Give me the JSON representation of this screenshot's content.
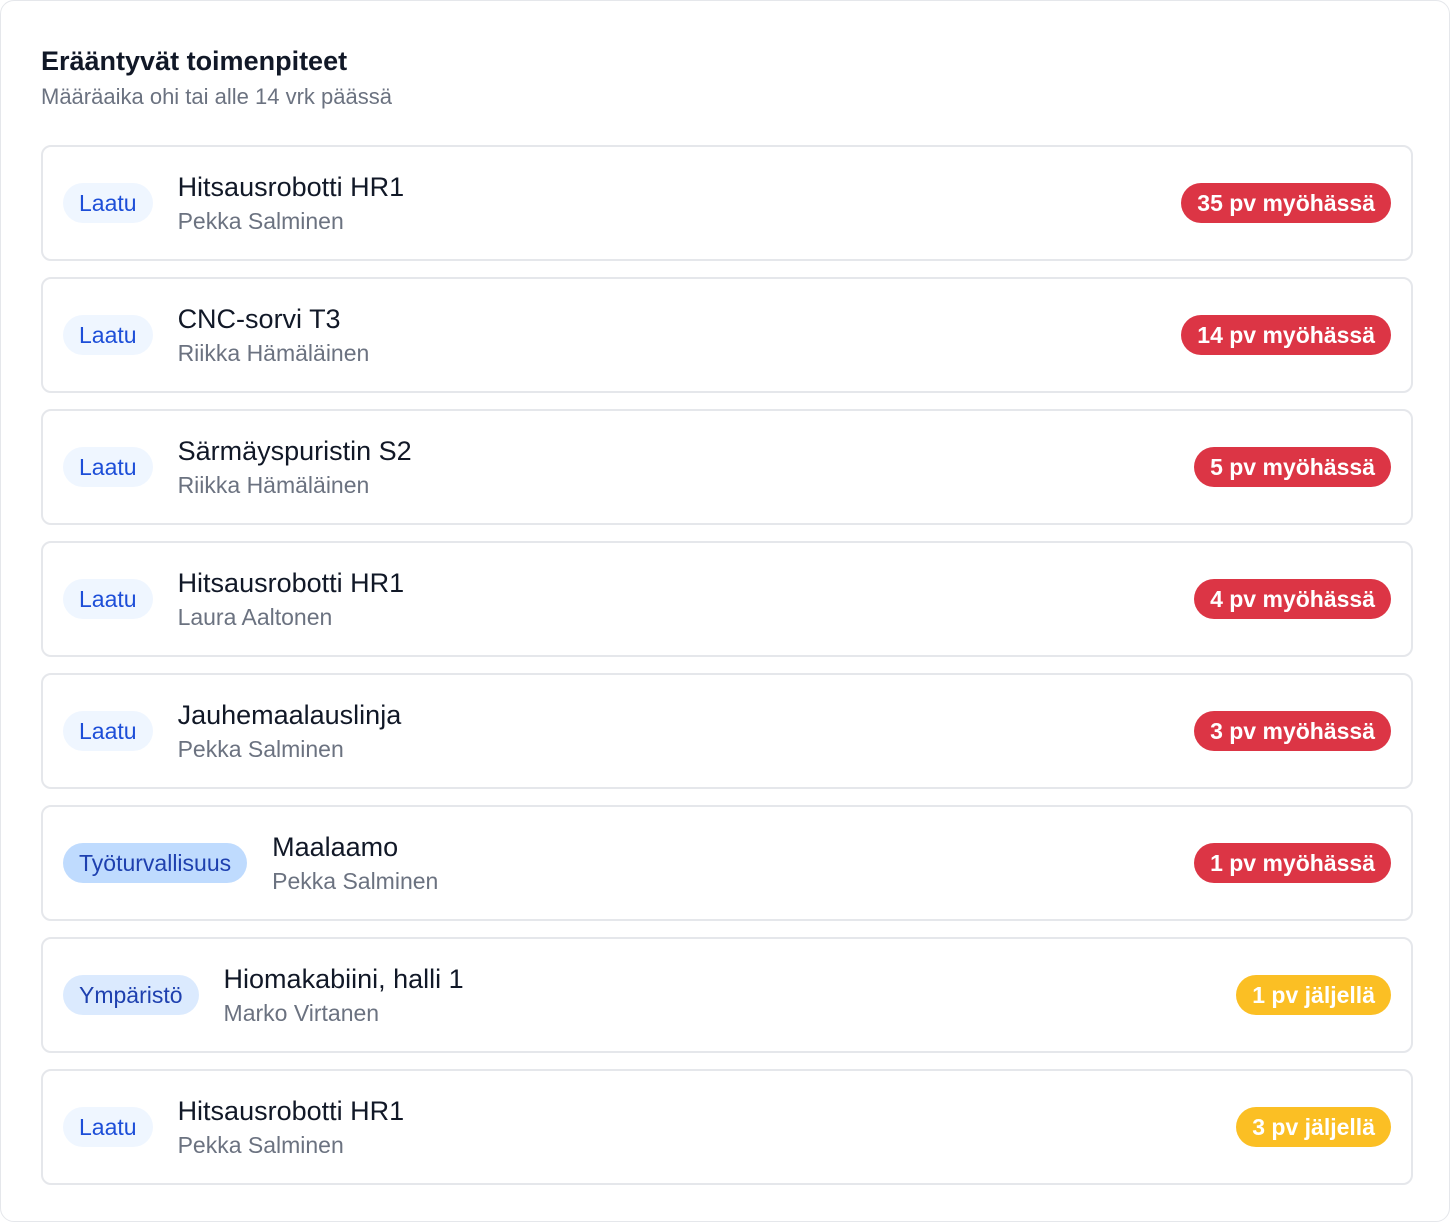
{
  "header": {
    "title": "Erääntyvät toimenpiteet",
    "subtitle": "Määräaika ohi tai alle 14 vrk päässä"
  },
  "colors": {
    "overdue": "#dc3545",
    "due_soon": "#fbbf24",
    "tag_text": "#1d4ed8"
  },
  "items": [
    {
      "category": "Laatu",
      "target": "Hitsausrobotti HR1",
      "owner": "Pekka Salminen",
      "status": "35 pv myöhässä",
      "status_type": "overdue"
    },
    {
      "category": "Laatu",
      "target": "CNC-sorvi T3",
      "owner": "Riikka Hämäläinen",
      "status": "14 pv myöhässä",
      "status_type": "overdue"
    },
    {
      "category": "Laatu",
      "target": "Särmäyspuristin S2",
      "owner": "Riikka Hämäläinen",
      "status": "5 pv myöhässä",
      "status_type": "overdue"
    },
    {
      "category": "Laatu",
      "target": "Hitsausrobotti HR1",
      "owner": "Laura Aaltonen",
      "status": "4 pv myöhässä",
      "status_type": "overdue"
    },
    {
      "category": "Laatu",
      "target": "Jauhemaalauslinja",
      "owner": "Pekka Salminen",
      "status": "3 pv myöhässä",
      "status_type": "overdue"
    },
    {
      "category": "Työturvallisuus",
      "target": "Maalaamo",
      "owner": "Pekka Salminen",
      "status": "1 pv myöhässä",
      "status_type": "overdue"
    },
    {
      "category": "Ympäristö",
      "target": "Hiomakabiini, halli 1",
      "owner": "Marko Virtanen",
      "status": "1 pv jäljellä",
      "status_type": "due"
    },
    {
      "category": "Laatu",
      "target": "Hitsausrobotti HR1",
      "owner": "Pekka Salminen",
      "status": "3 pv jäljellä",
      "status_type": "due"
    }
  ]
}
